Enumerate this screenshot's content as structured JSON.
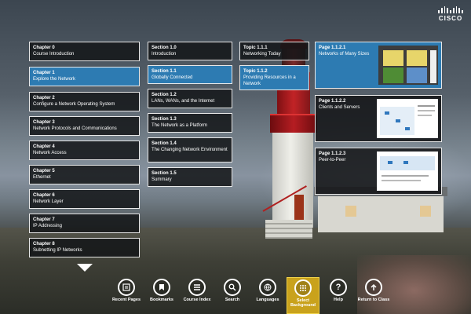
{
  "brand": {
    "logo_text": "CISCO"
  },
  "chapters": [
    {
      "title": "Chapter 0",
      "subtitle": "Course Introduction"
    },
    {
      "title": "Chapter 1",
      "subtitle": "Explore the Network"
    },
    {
      "title": "Chapter 2",
      "subtitle": "Configure a Network Operating System"
    },
    {
      "title": "Chapter 3",
      "subtitle": "Network Protocols and Communications"
    },
    {
      "title": "Chapter 4",
      "subtitle": "Network Access"
    },
    {
      "title": "Chapter 5",
      "subtitle": "Ethernet"
    },
    {
      "title": "Chapter 6",
      "subtitle": "Network Layer"
    },
    {
      "title": "Chapter 7",
      "subtitle": "IP Addressing"
    },
    {
      "title": "Chapter 8",
      "subtitle": "Subnetting IP Networks"
    }
  ],
  "sections": [
    {
      "title": "Section 1.0",
      "subtitle": "Introduction"
    },
    {
      "title": "Section 1.1",
      "subtitle": "Globally Connected"
    },
    {
      "title": "Section 1.2",
      "subtitle": "LANs, WANs, and the Internet"
    },
    {
      "title": "Section 1.3",
      "subtitle": "The Network as a Platform"
    },
    {
      "title": "Section 1.4",
      "subtitle": "The Changing Network Environment"
    },
    {
      "title": "Section 1.5",
      "subtitle": "Summary"
    }
  ],
  "topics": [
    {
      "title": "Topic 1.1.1",
      "subtitle": "Networking Today"
    },
    {
      "title": "Topic 1.1.2",
      "subtitle": "Providing Resources in a Network"
    }
  ],
  "pages": [
    {
      "title": "Page 1.1.2.1",
      "subtitle": "Networks of Many Sizes"
    },
    {
      "title": "Page 1.1.2.2",
      "subtitle": "Clients and Servers"
    },
    {
      "title": "Page 1.1.2.3",
      "subtitle": "Peer-to-Peer"
    }
  ],
  "toolbar": {
    "recent": "Recent Pages",
    "bookmarks": "Bookmarks",
    "index": "Course Index",
    "search": "Search",
    "languages": "Languages",
    "background": "Select Background",
    "help": "Help",
    "return": "Return to Class"
  },
  "selection": {
    "chapter": "Chapter 1",
    "section": "Section 1.1",
    "topic": "Topic 1.1.2",
    "page": "Page 1.1.2.1",
    "toolbar": "Select Background"
  },
  "colors": {
    "selected": "#2d7bb2",
    "toolbar_selected": "#c9a21c",
    "card_bg": "#141618"
  },
  "icons": [
    "scroll-down-arrow",
    "recent-pages-icon",
    "bookmark-icon",
    "course-index-icon",
    "search-icon",
    "languages-icon",
    "grid-icon",
    "help-icon",
    "return-arrow-icon"
  ]
}
